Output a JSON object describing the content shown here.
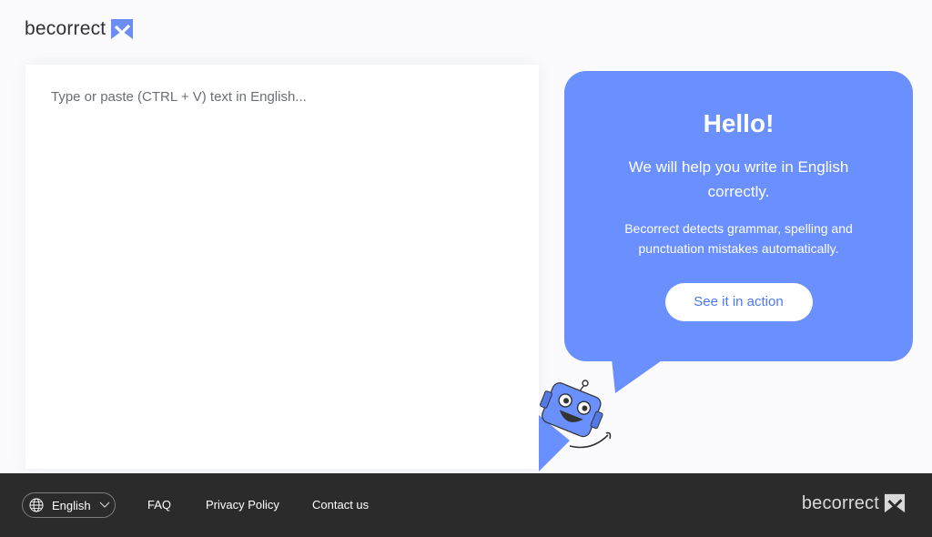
{
  "header": {
    "logo_text": "becorrect"
  },
  "editor": {
    "placeholder": "Type or paste (CTRL + V) text in English..."
  },
  "bubble": {
    "title": "Hello!",
    "lead": "We will help you write in English correctly.",
    "description": "Becorrect detects grammar, spelling and punctuation mistakes automatically.",
    "cta_label": "See it in action"
  },
  "footer": {
    "language": "English",
    "links": [
      "FAQ",
      "Privacy Policy",
      "Contact us"
    ],
    "logo_text": "becorrect"
  },
  "colors": {
    "accent": "#6a8ffe",
    "logo_mark": "#6b8ef5",
    "footer_bg": "#2b2b2b"
  },
  "icons": [
    "logo-check-icon",
    "globe-icon",
    "chevron-down-icon",
    "robot-mascot"
  ]
}
